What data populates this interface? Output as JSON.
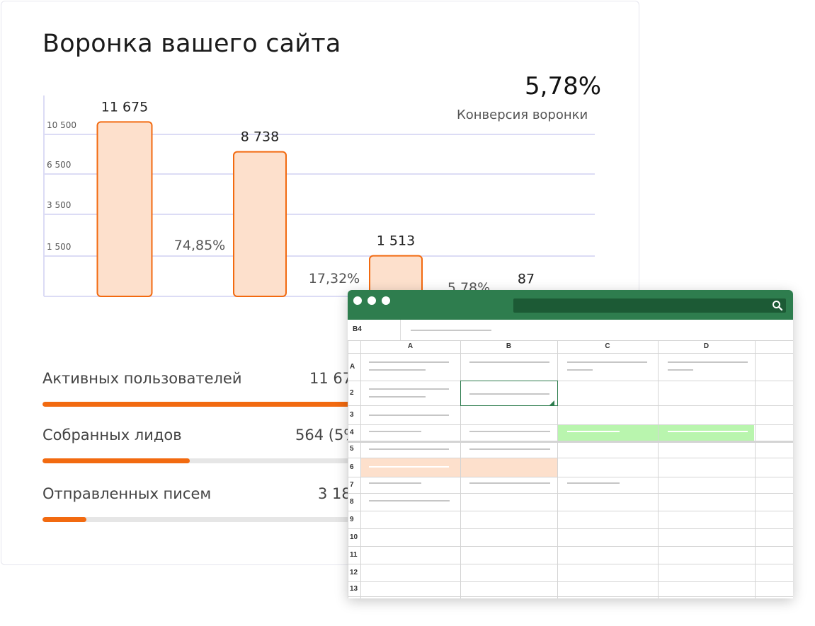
{
  "card": {
    "title": "Воронка вашего сайта",
    "conversion_value": "5,78%",
    "conversion_label": "Конверсия воронки"
  },
  "chart_data": {
    "type": "bar",
    "title": "Воронка вашего сайта",
    "categories": [
      "",
      "",
      "",
      ""
    ],
    "values": [
      11675,
      8738,
      1513,
      87
    ],
    "value_labels": [
      "11 675",
      "8 738",
      "1 513",
      "87"
    ],
    "step_conversions": [
      "74,85%",
      "17,32%",
      "5,78%"
    ],
    "y_ticks": [
      1500,
      3500,
      6500,
      10500
    ],
    "y_tick_labels": [
      "1 500",
      "3 500",
      "6 500",
      "10 500"
    ],
    "xlabel": "",
    "ylabel": "",
    "grid": true,
    "bar_fill": "#fde0cc",
    "bar_stroke": "#f26a10",
    "grid_color": "#dcdcf5"
  },
  "metrics": [
    {
      "label": "Активных пользователей",
      "value": "11 67",
      "progress": 1.0
    },
    {
      "label": "Собранных лидов",
      "value": "564 (5%",
      "progress": 0.267
    },
    {
      "label": "Отправленных писем",
      "value": "3 18",
      "progress": 0.08
    }
  ],
  "spreadsheet": {
    "cell_ref": "B4",
    "columns": [
      "A",
      "B",
      "C",
      "D"
    ],
    "rows": [
      "A",
      "2",
      "3",
      "4",
      "5",
      "6",
      "7",
      "8",
      "9",
      "10",
      "11",
      "12",
      "13"
    ],
    "icons": [
      "search-icon"
    ],
    "header_color": "#2e7d4e",
    "highlight_green": "#b9f5ae",
    "highlight_orange": "#fde0cc"
  }
}
